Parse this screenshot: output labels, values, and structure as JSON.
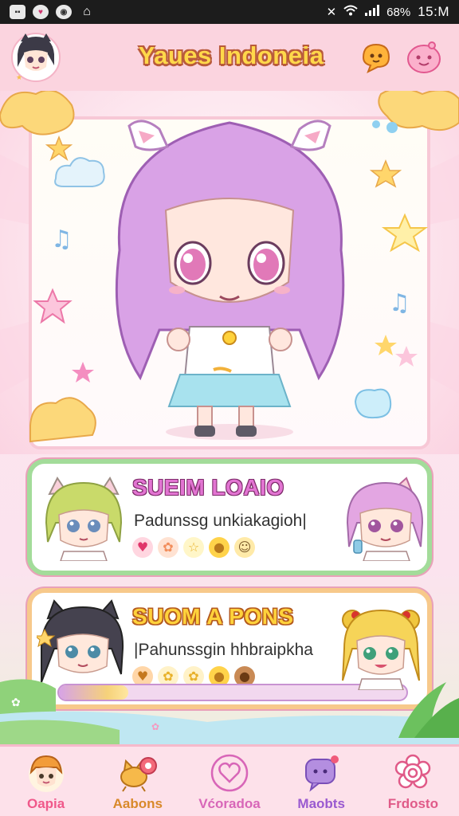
{
  "status_bar": {
    "battery": "68%",
    "time": "15:M",
    "left_icons": [
      "image-icon",
      "heart-icon",
      "circle-icon",
      "home-icon"
    ]
  },
  "header": {
    "title": "Yaues Indoneia"
  },
  "cards": [
    {
      "title": "SUEIM LOAIO",
      "subtitle": "Padunssg unkiakagioh|",
      "icons": [
        "heart-icon",
        "flower-icon",
        "star-icon",
        "coin-icon",
        "face-icon"
      ]
    },
    {
      "title": "SUOM A PONS",
      "subtitle": "|Pahunssgin hhbraipkha",
      "icons": [
        "heart-icon",
        "flower-icon",
        "flower-icon",
        "coin-icon",
        "cookie-icon"
      ],
      "progress": 0.2
    }
  ],
  "nav": [
    {
      "label": "Oapia",
      "icon": "avatar-icon",
      "color": "#f0588a"
    },
    {
      "label": "Aabons",
      "icon": "cat-rattle-icon",
      "color": "#d9892a"
    },
    {
      "label": "Vćoradoa",
      "icon": "heart-icon",
      "color": "#d866b8"
    },
    {
      "label": "Maobts",
      "icon": "chat-icon",
      "color": "#9a5ad0"
    },
    {
      "label": "Frdosto",
      "icon": "gear-icon",
      "color": "#e05a88"
    }
  ],
  "colors": {
    "accent_pink": "#fbd4df",
    "card_green": "#a3dc9a",
    "card_orange": "#f7c98b",
    "title_yellow": "#ffd84a"
  }
}
